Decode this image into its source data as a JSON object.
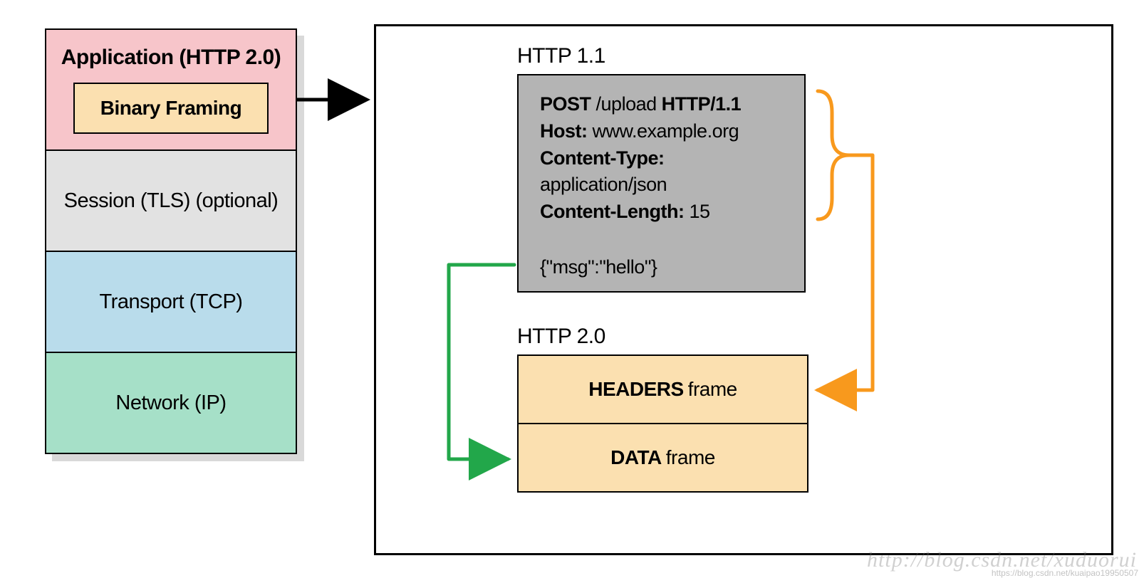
{
  "stack": {
    "application": "Application (HTTP 2.0)",
    "binaryFraming": "Binary Framing",
    "session": "Session (TLS) (optional)",
    "transport": "Transport (TCP)",
    "network": "Network (IP)"
  },
  "http11": {
    "label": "HTTP 1.1",
    "request": {
      "method": "POST",
      "path": "/upload",
      "version": "HTTP/1.1",
      "hostLabel": "Host:",
      "host": "www.example.org",
      "ctLabel": "Content-Type:",
      "ct": "application/json",
      "clLabel": "Content-Length:",
      "cl": "15"
    },
    "body": "{\"msg\":\"hello\"}"
  },
  "http20": {
    "label": "HTTP 2.0",
    "headersFrameBold": "HEADERS",
    "headersFrameRest": "frame",
    "dataFrameBold": "DATA",
    "dataFrameRest": "frame"
  },
  "watermark": {
    "big": "http://blog.csdn.net/xuduorui",
    "small": "https://blog.csdn.net/kuaipao19950507"
  }
}
